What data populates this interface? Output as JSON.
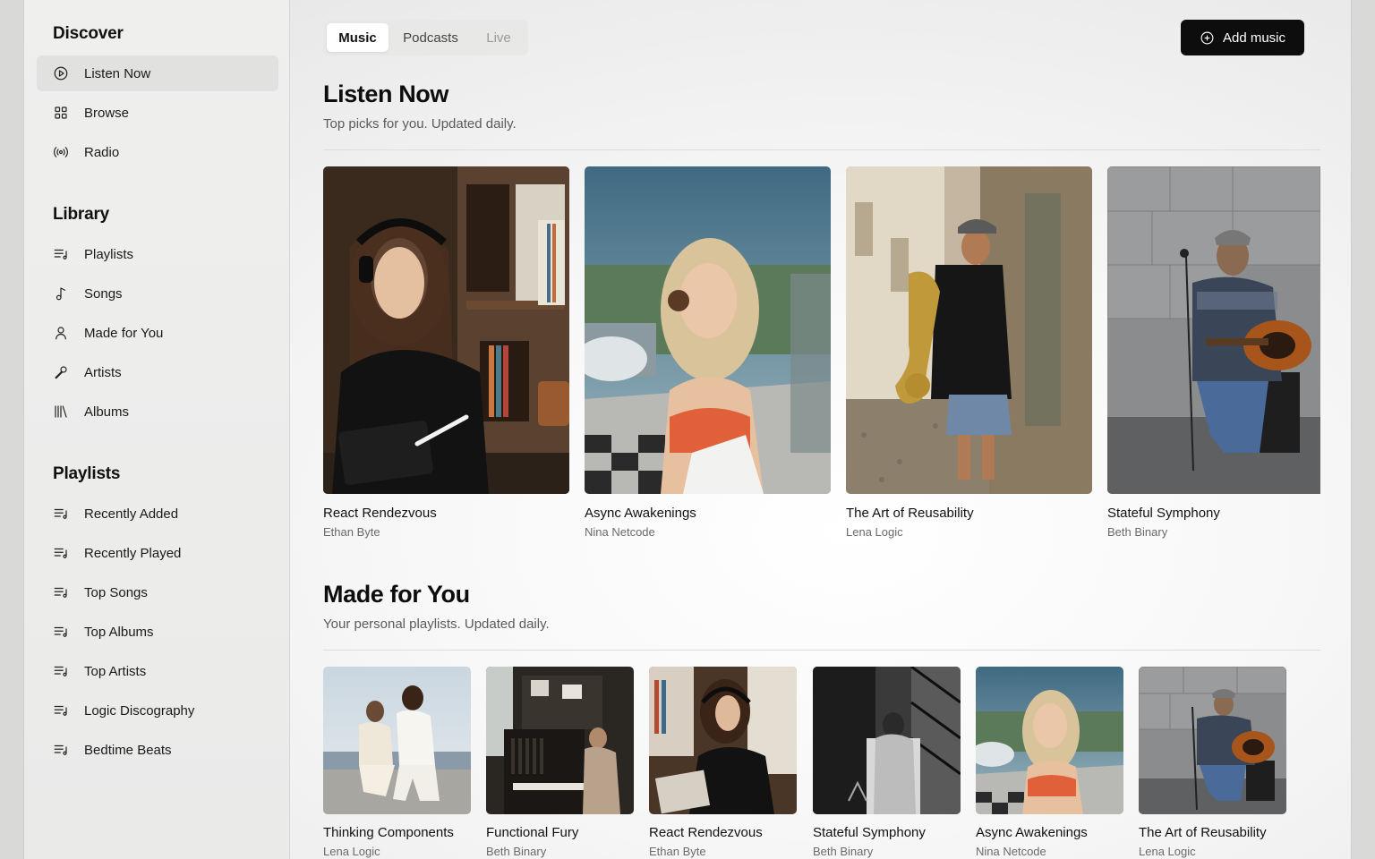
{
  "sidebar": {
    "discover": {
      "title": "Discover",
      "items": [
        {
          "label": "Listen Now",
          "icon": "play-circle-icon"
        },
        {
          "label": "Browse",
          "icon": "grid-icon"
        },
        {
          "label": "Radio",
          "icon": "radio-icon"
        }
      ]
    },
    "library": {
      "title": "Library",
      "items": [
        {
          "label": "Playlists",
          "icon": "playlist-icon"
        },
        {
          "label": "Songs",
          "icon": "music-note-icon"
        },
        {
          "label": "Made for You",
          "icon": "user-icon"
        },
        {
          "label": "Artists",
          "icon": "microphone-icon"
        },
        {
          "label": "Albums",
          "icon": "library-icon"
        }
      ]
    },
    "playlists": {
      "title": "Playlists",
      "items": [
        {
          "label": "Recently Added",
          "icon": "playlist-icon"
        },
        {
          "label": "Recently Played",
          "icon": "playlist-icon"
        },
        {
          "label": "Top Songs",
          "icon": "playlist-icon"
        },
        {
          "label": "Top Albums",
          "icon": "playlist-icon"
        },
        {
          "label": "Top Artists",
          "icon": "playlist-icon"
        },
        {
          "label": "Logic Discography",
          "icon": "playlist-icon"
        },
        {
          "label": "Bedtime Beats",
          "icon": "playlist-icon"
        }
      ]
    }
  },
  "tabs": [
    "Music",
    "Podcasts",
    "Live"
  ],
  "add_button": {
    "label": "Add music",
    "icon": "plus-circle-icon"
  },
  "listen_now": {
    "title": "Listen Now",
    "subtitle": "Top picks for you. Updated daily.",
    "albums": [
      {
        "title": "React Rendezvous",
        "artist": "Ethan Byte"
      },
      {
        "title": "Async Awakenings",
        "artist": "Nina Netcode"
      },
      {
        "title": "The Art of Reusability",
        "artist": "Lena Logic"
      },
      {
        "title": "Stateful Symphony",
        "artist": "Beth Binary"
      }
    ]
  },
  "made_for_you": {
    "title": "Made for You",
    "subtitle": "Your personal playlists. Updated daily.",
    "albums": [
      {
        "title": "Thinking Components",
        "artist": "Lena Logic"
      },
      {
        "title": "Functional Fury",
        "artist": "Beth Binary"
      },
      {
        "title": "React Rendezvous",
        "artist": "Ethan Byte"
      },
      {
        "title": "Stateful Symphony",
        "artist": "Beth Binary"
      },
      {
        "title": "Async Awakenings",
        "artist": "Nina Netcode"
      },
      {
        "title": "The Art of Reusability",
        "artist": "Lena Logic"
      }
    ]
  }
}
